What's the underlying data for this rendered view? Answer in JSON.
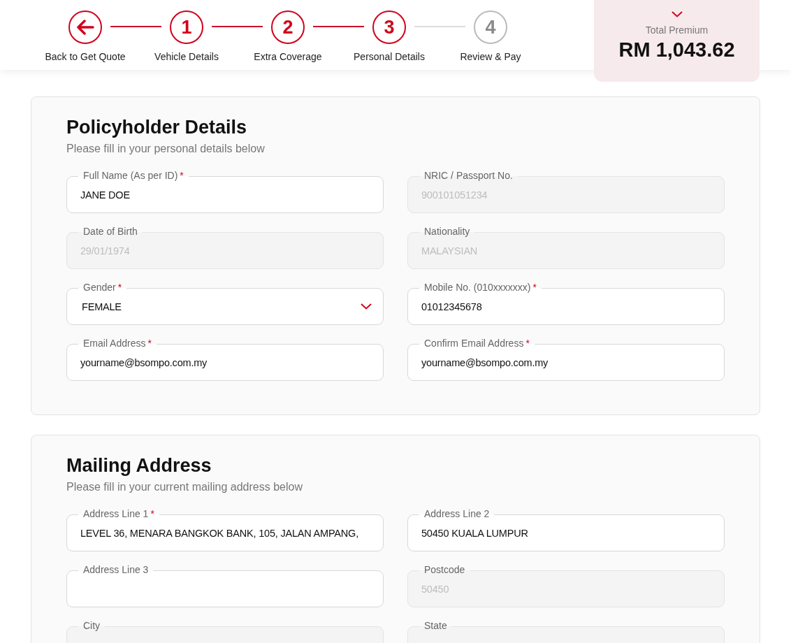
{
  "steps": [
    {
      "kind": "back",
      "label": "Back to Get Quote",
      "done": true
    },
    {
      "kind": "number",
      "number": "1",
      "label": "Vehicle Details",
      "done": true
    },
    {
      "kind": "number",
      "number": "2",
      "label": "Extra Coverage",
      "done": true
    },
    {
      "kind": "number",
      "number": "3",
      "label": "Personal Details",
      "done": true
    },
    {
      "kind": "number",
      "number": "4",
      "label": "Review & Pay",
      "done": false
    }
  ],
  "premium": {
    "label": "Total Premium",
    "amount": "RM 1,043.62"
  },
  "sections": [
    {
      "title": "Policyholder Details",
      "subtitle": "Please fill in your personal details below",
      "fields": [
        {
          "kind": "text",
          "label": "Full Name (As per ID)",
          "required_mark": "*",
          "value": "JANE DOE",
          "disabled": false
        },
        {
          "kind": "text",
          "label": "NRIC / Passport No.",
          "value": "900101051234",
          "disabled": true
        },
        {
          "kind": "text",
          "label": "Date of Birth",
          "value": "29/01/1974",
          "disabled": true
        },
        {
          "kind": "text",
          "label": "Nationality",
          "value": "MALAYSIAN",
          "disabled": true
        },
        {
          "kind": "select",
          "label": "Gender",
          "required_mark": "*",
          "value": "FEMALE",
          "disabled": false
        },
        {
          "kind": "text",
          "label": "Mobile No. (010xxxxxxx)",
          "required_mark": "*",
          "value": "01012345678",
          "disabled": false
        },
        {
          "kind": "text",
          "label": "Email Address",
          "required_mark": "*",
          "value": "yourname@bsompo.com.my",
          "disabled": false
        },
        {
          "kind": "text",
          "label": "Confirm Email Address",
          "required_mark": "*",
          "value": "yourname@bsompo.com.my",
          "disabled": false
        }
      ]
    },
    {
      "title": "Mailing Address",
      "subtitle": "Please fill in your current mailing address below",
      "fields": [
        {
          "kind": "text",
          "label": "Address Line 1",
          "required_mark": "*",
          "value": "LEVEL 36, MENARA BANGKOK BANK, 105, JALAN AMPANG,",
          "disabled": false
        },
        {
          "kind": "text",
          "label": "Address Line 2",
          "value": "50450 KUALA LUMPUR",
          "disabled": false
        },
        {
          "kind": "text",
          "label": "Address Line 3",
          "disabled": false
        },
        {
          "kind": "text",
          "label": "Postcode",
          "value": "50450",
          "disabled": true
        },
        {
          "kind": "text",
          "label": "City",
          "disabled": true
        },
        {
          "kind": "text",
          "label": "State",
          "disabled": true
        }
      ]
    }
  ]
}
